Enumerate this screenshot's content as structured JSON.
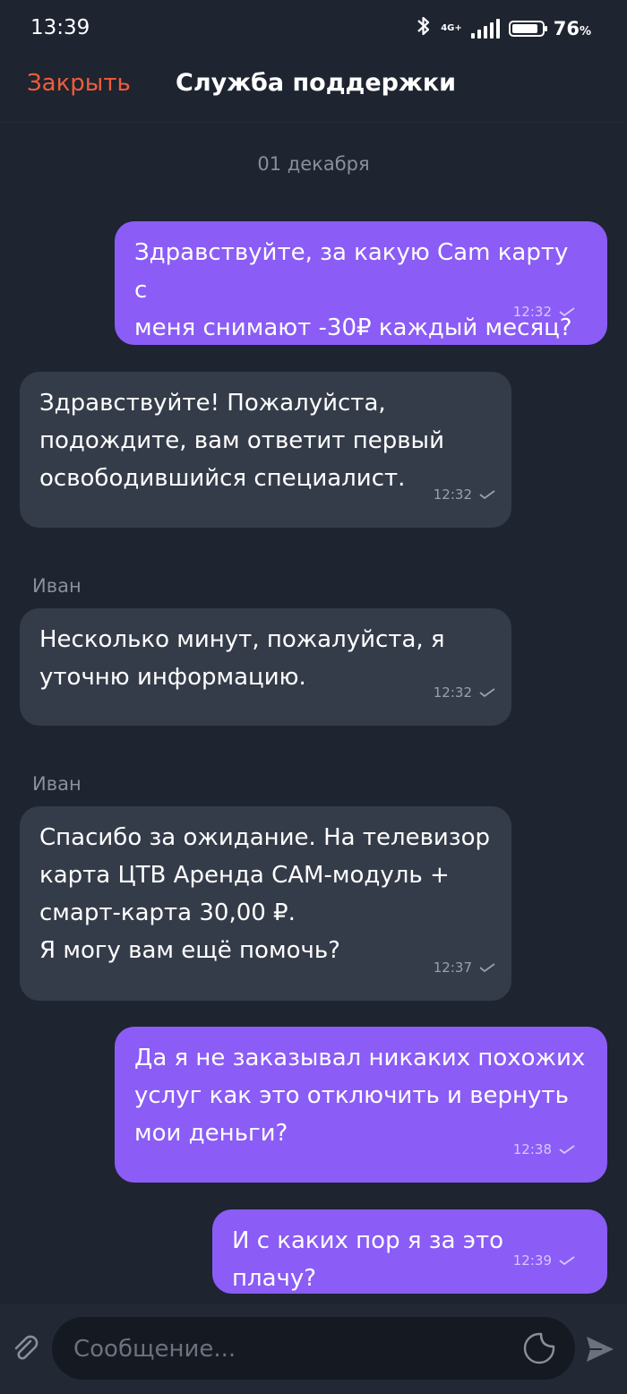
{
  "status_bar": {
    "time": "13:39",
    "network": "4G+",
    "battery_percent": "76",
    "battery_unit": "%"
  },
  "header": {
    "close_label": "Закрыть",
    "title": "Служба поддержки"
  },
  "chat": {
    "date": "01 декабря",
    "messages": [
      {
        "direction": "outgoing",
        "sender": "",
        "text": "Здравствуйте, за какую Cam карту с\nменя снимают -30₽ каждый  месяц?",
        "time": "12:32"
      },
      {
        "direction": "incoming",
        "sender": "",
        "text": "Здравствуйте! Пожалуйста,\nподождите, вам ответит первый\nосвободившийся специалист.",
        "time": "12:32"
      },
      {
        "direction": "incoming",
        "sender": "Иван",
        "text": "Несколько минут, пожалуйста, я\nуточню информацию.",
        "time": "12:32"
      },
      {
        "direction": "incoming",
        "sender": "Иван",
        "text": "Спасибо за ожидание. На телевизор\nкарта ЦТВ Аренда CAM-модуль +\nсмарт-карта 30,00 ₽.\nЯ могу вам ещё помочь?",
        "time": "12:37"
      },
      {
        "direction": "outgoing",
        "sender": "",
        "text": "Да я не заказывал никаких похожих\nуслуг как это отключить и вернуть\nмои деньги?",
        "time": "12:38"
      },
      {
        "direction": "outgoing",
        "sender": "",
        "text": "И с каких пор я за это плачу?",
        "time": "12:39"
      }
    ]
  },
  "composer": {
    "placeholder": "Сообщение..."
  },
  "icons": {
    "attach": "paperclip-icon",
    "sticker": "sticker-icon",
    "send": "send-icon"
  },
  "colors": {
    "background": "#1e2430",
    "outgoing_bubble": "#8b5cf6",
    "incoming_bubble": "#353c49",
    "accent_close": "#ef5d3a"
  }
}
